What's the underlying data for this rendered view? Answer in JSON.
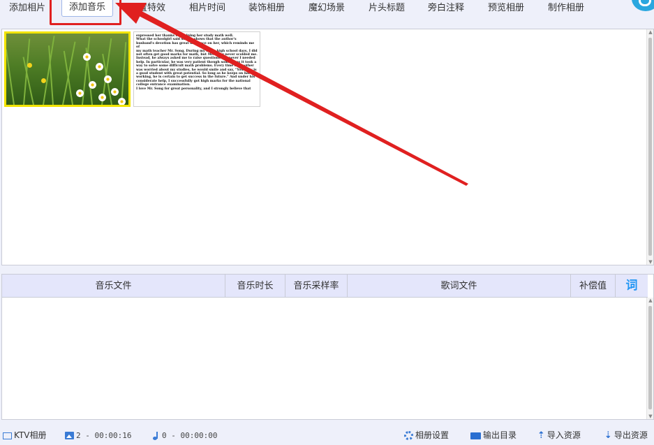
{
  "toolbar": {
    "tabs": [
      {
        "label": "添加相片"
      },
      {
        "label": "添加音乐"
      },
      {
        "label": "设置特效"
      },
      {
        "label": "相片时间"
      },
      {
        "label": "装饰相册"
      },
      {
        "label": "魔幻场景"
      },
      {
        "label": "片头标题"
      },
      {
        "label": "旁白注释"
      },
      {
        "label": "预览相册"
      },
      {
        "label": "制作相册"
      }
    ],
    "active_tab": "添加音乐"
  },
  "photo_panel": {
    "thumbnails": [
      {
        "kind": "flower-field-photo",
        "selected": true
      },
      {
        "kind": "text-document",
        "lines": [
          "expressed her thanks for helping her study math well.",
          "What the schoolgirl said simply shows that the author's",
          "husband's devotion has great influence on her, which reminds me of",
          "my math teacher Mr. Song. During my three high school days, I did",
          "not often get good marks for math, but Mr. Song never scolded me.",
          "Instead, he always asked me to raise questions whenever I needed",
          "help. In particular, he was very patient though sometimes it took a",
          "way to solve some difficult math problems. Every time my mother",
          "was worried about my studies, he would smile and say, \"Your boy is",
          "a good student with great potential. So long as he keeps on hard-",
          "working, he is certain to get success in the future.\" And under his",
          "considerate help, I successfully got high marks for the national",
          "college entrance examination.",
          "I love Mr. Song for great personality, and I strongly believe that"
        ]
      }
    ]
  },
  "music_table": {
    "columns": [
      "音乐文件",
      "音乐时长",
      "音乐采样率",
      "歌词文件",
      "补偿值",
      "词"
    ],
    "rows": []
  },
  "status_bar": {
    "ktv_label": "KTV相册",
    "photo_stat": "2 - 00:00:16",
    "music_stat": "0 - 00:00:00",
    "album_settings": "相册设置",
    "output_dir": "输出目录",
    "import_res": "导入资源",
    "export_res": "导出资源"
  },
  "colors": {
    "accent": "#2196f3",
    "annotation_red": "#e02020",
    "header_bg": "#e4e6fb",
    "selection_yellow": "#f2e400"
  }
}
